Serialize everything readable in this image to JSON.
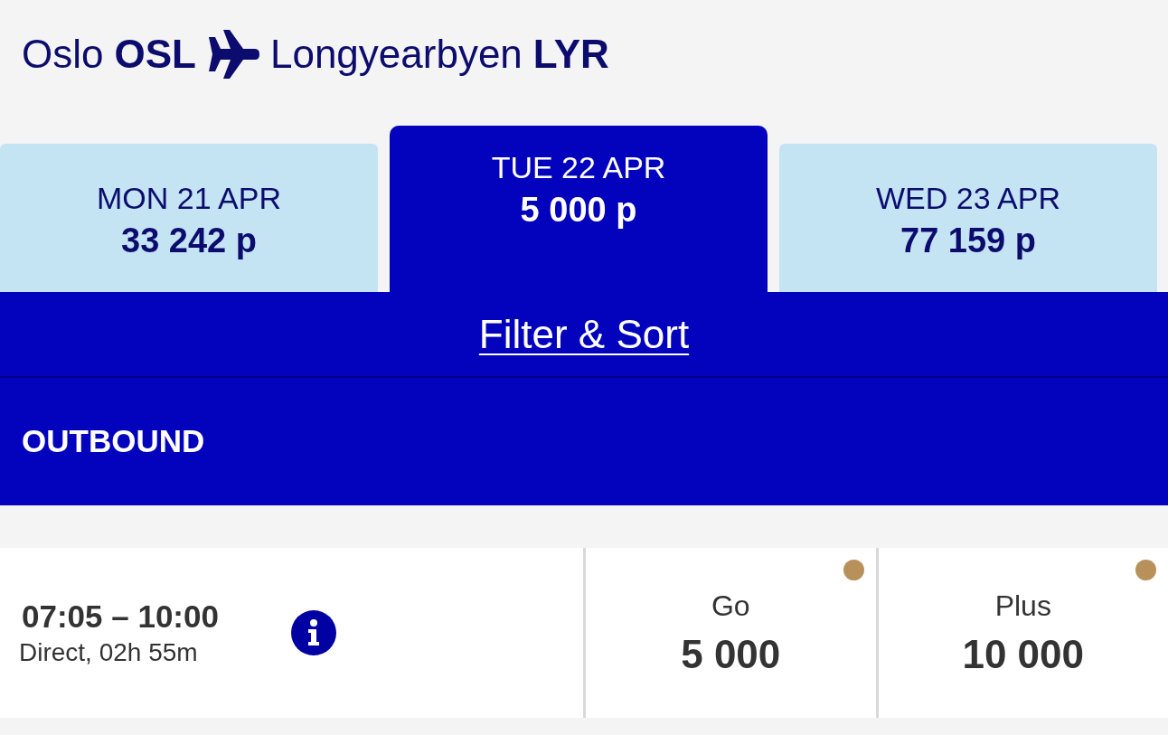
{
  "route": {
    "origin_city": "Oslo",
    "origin_code": "OSL",
    "destination_city": "Longyearbyen",
    "destination_code": "LYR"
  },
  "date_tabs": [
    {
      "day": "MON 21 APR",
      "price": "33 242 p",
      "selected": false
    },
    {
      "day": "TUE 22 APR",
      "price": "5 000 p",
      "selected": true
    },
    {
      "day": "WED 23 APR",
      "price": "77 159 p",
      "selected": false
    }
  ],
  "filter_sort": {
    "label": "Filter & Sort"
  },
  "section": {
    "title": "OUTBOUND"
  },
  "flights": [
    {
      "time": "07:05 – 10:00",
      "details": "Direct, 02h 55m",
      "fares": [
        {
          "name": "Go",
          "price": "5 000",
          "color": "#b8915a"
        },
        {
          "name": "Plus",
          "price": "10 000",
          "color": "#b8915a"
        }
      ]
    }
  ]
}
